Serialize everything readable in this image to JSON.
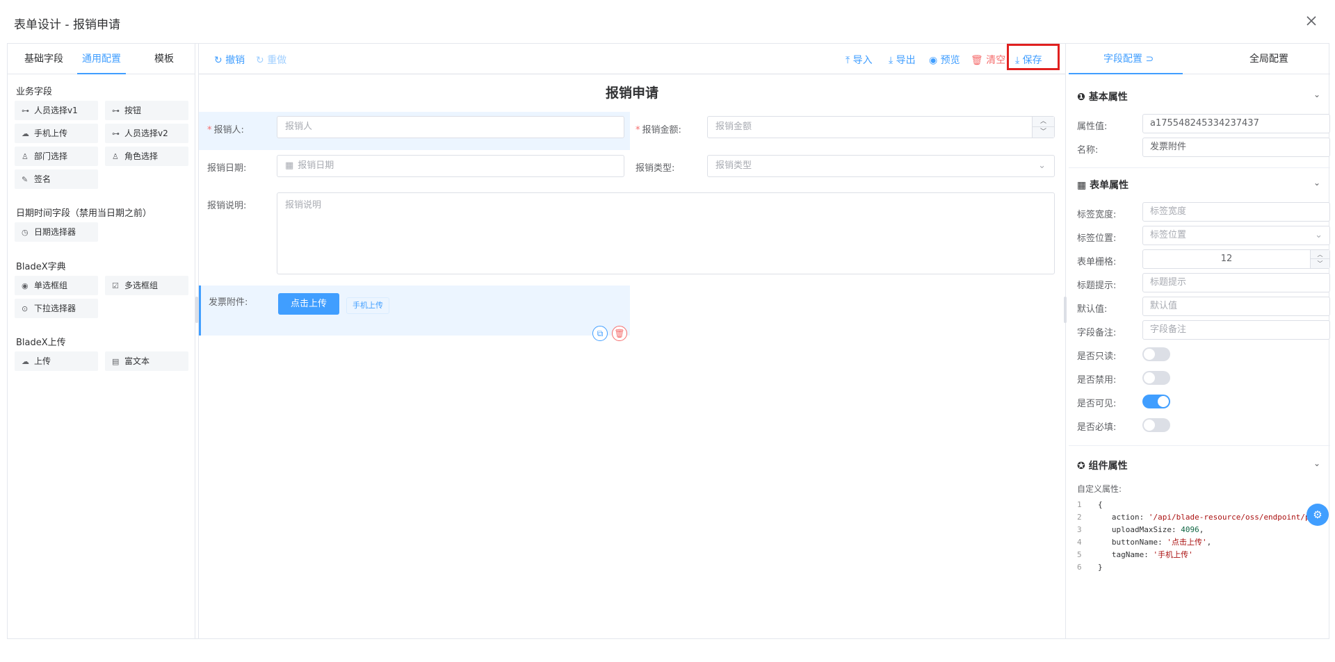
{
  "dialog": {
    "title": "表单设计 - 报销申请"
  },
  "left": {
    "tabs": [
      {
        "label": "基础字段"
      },
      {
        "label": "通用配置"
      },
      {
        "label": "模板"
      }
    ],
    "groups": [
      {
        "title": "业务字段",
        "items": [
          "人员选择v1",
          "按钮",
          "手机上传",
          "人员选择v2",
          "部门选择",
          "角色选择",
          "签名"
        ]
      },
      {
        "title": "日期时间字段（禁用当日期之前）",
        "items": [
          "日期选择器"
        ]
      },
      {
        "title": "BladeX字典",
        "items": [
          "单选框组",
          "多选框组",
          "下拉选择器"
        ]
      },
      {
        "title": "BladeX上传",
        "items": [
          "上传",
          "富文本"
        ]
      }
    ]
  },
  "toolbar": {
    "undo": "撤销",
    "redo": "重做",
    "import": "导入",
    "export": "导出",
    "preview": "预览",
    "clear": "清空",
    "save": "保存"
  },
  "form": {
    "title": "报销申请",
    "applicant_label": "报销人:",
    "applicant_placeholder": "报销人",
    "amount_label": "报销金额:",
    "amount_placeholder": "报销金额",
    "date_label": "报销日期:",
    "date_placeholder": "报销日期",
    "type_label": "报销类型:",
    "type_placeholder": "报销类型",
    "desc_label": "报销说明:",
    "desc_placeholder": "报销说明",
    "attach_label": "发票附件:",
    "upload_button": "点击上传",
    "upload_tag": "手机上传"
  },
  "right": {
    "tabs": [
      {
        "label": "字段配置"
      },
      {
        "label": "全局配置"
      }
    ],
    "basic": {
      "title": "基本属性",
      "prop_label": "属性值:",
      "prop_value": "a175548245334237437",
      "name_label": "名称:",
      "name_value": "发票附件"
    },
    "formprops": {
      "title": "表单属性",
      "label_width": "标签宽度:",
      "label_width_ph": "标签宽度",
      "label_pos": "标签位置:",
      "label_pos_ph": "标签位置",
      "grid": "表单栅格:",
      "grid_value": "12",
      "tip": "标题提示:",
      "tip_ph": "标题提示",
      "default": "默认值:",
      "default_ph": "默认值",
      "remark": "字段备注:",
      "remark_ph": "字段备注",
      "readonly": "是否只读:",
      "disabled": "是否禁用:",
      "visible": "是否可见:",
      "required": "是否必填:"
    },
    "component": {
      "title": "组件属性",
      "custom_label": "自定义属性:",
      "lines": [
        {
          "n": "1",
          "t": "{"
        },
        {
          "n": "2",
          "k": "action",
          "v": "'/api/blade-resource/oss/endpoint/put-"
        },
        {
          "n": "3",
          "k": "uploadMaxSize",
          "v": "4096"
        },
        {
          "n": "4",
          "k": "buttonName",
          "v": "'点击上传'"
        },
        {
          "n": "5",
          "k": "tagName",
          "v": "'手机上传'"
        },
        {
          "n": "6",
          "t": "}"
        }
      ]
    }
  }
}
